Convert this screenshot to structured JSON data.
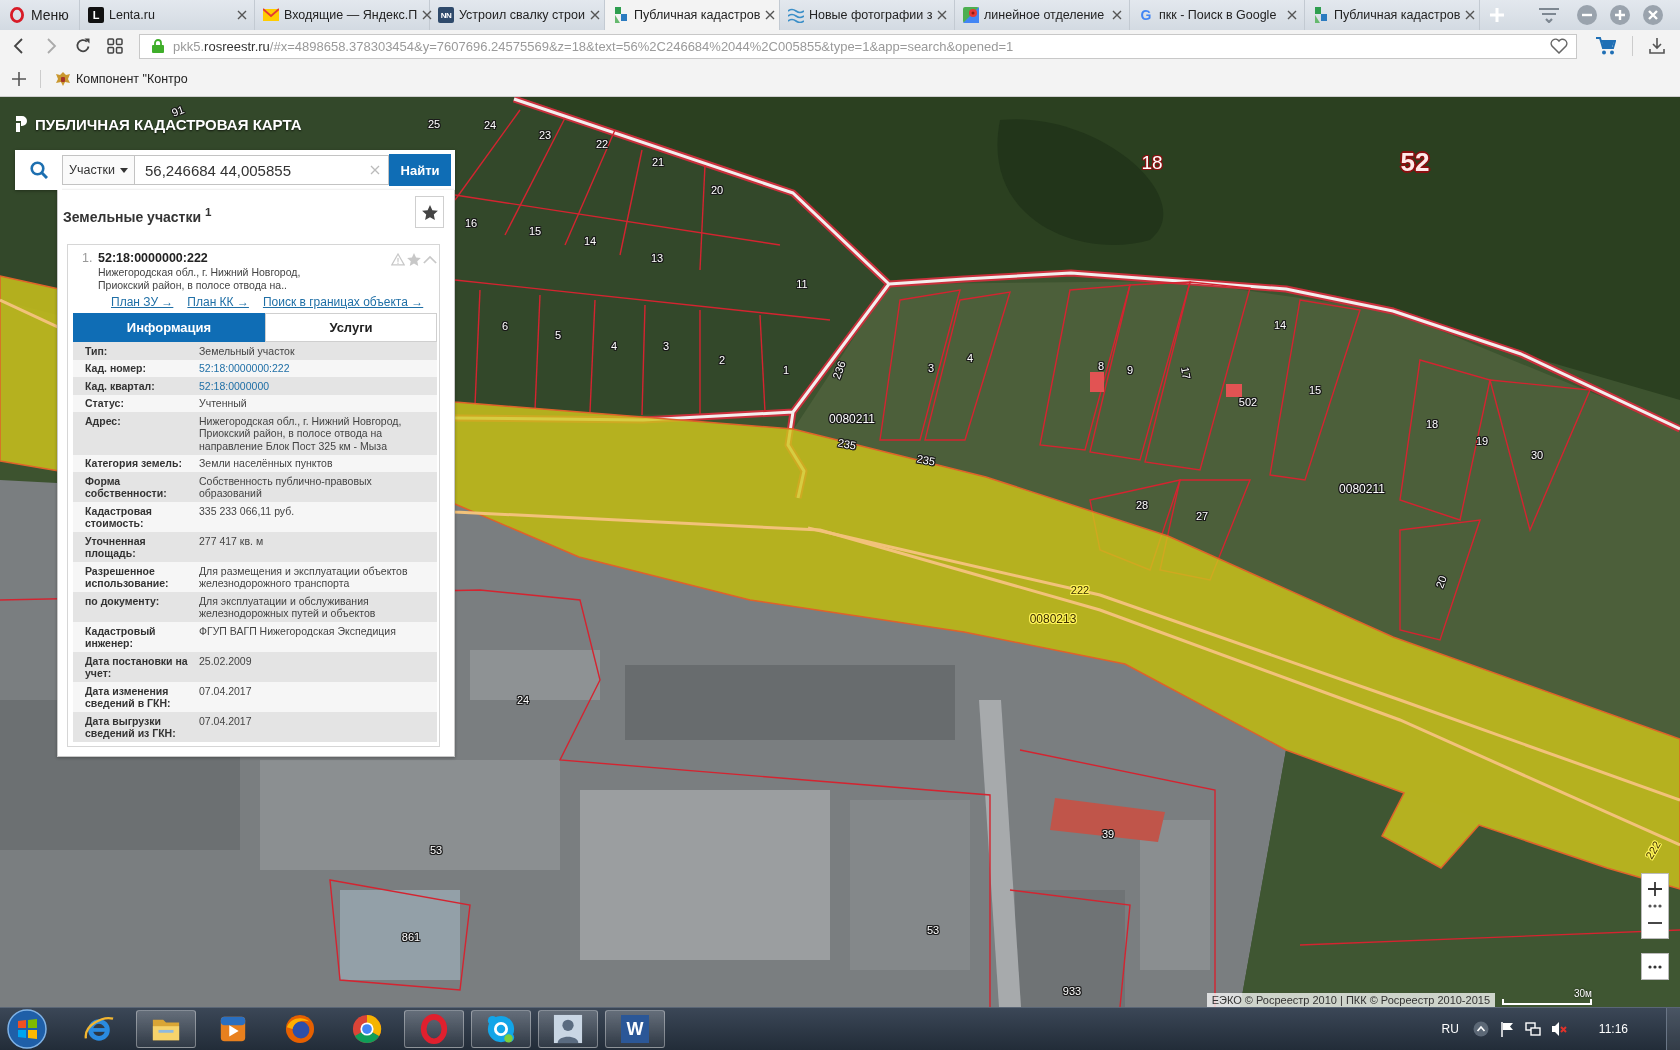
{
  "browser": {
    "menu_label": "Меню",
    "tabs": [
      {
        "title": "Lenta.ru",
        "kind": "lenta",
        "icon_text": "L",
        "selected": false
      },
      {
        "title": "Входящие — Яндекс.П",
        "kind": "mail",
        "selected": false
      },
      {
        "title": "Устроил свалку строи",
        "kind": "nn",
        "icon_text": "NN",
        "selected": false
      },
      {
        "title": "Публичная кадастров",
        "kind": "cadastre",
        "selected": true
      },
      {
        "title": "Новые фотографии з",
        "kind": "photos",
        "selected": false
      },
      {
        "title": "линейное отделение",
        "kind": "maps",
        "selected": false
      },
      {
        "title": "пкк - Поиск в Google",
        "kind": "google",
        "icon_text": "G",
        "selected": false
      },
      {
        "title": "Публичная кадастров",
        "kind": "cadastre",
        "selected": false
      }
    ],
    "address": {
      "prefix": "pkk5.",
      "domain": "rosreestr.ru",
      "path": "/#x=4898658.378303454&y=7607696.24575569&z=18&text=56%2C246684%2044%2C005855&type=1&app=search&opened=1"
    },
    "bookmarks": [
      {
        "label": "Компонент \"Контро"
      }
    ]
  },
  "map": {
    "app_title": "ПУБЛИЧНАЯ КАДАСТРОВАЯ КАРТА",
    "search": {
      "category": "Участки",
      "value": "56,246684 44,005855",
      "button": "Найти"
    },
    "results": {
      "title": "Земельные участки $^{1}$",
      "items": [
        {
          "number": "1.",
          "cadastral_number": "52:18:0000000:222",
          "address": "Нижегородская обл., г. Нижний Новгород, Приокский район, в полосе отвода на..",
          "links": [
            "План ЗУ →",
            "План КК →",
            "Поиск в границах объекта →"
          ],
          "tabs": [
            {
              "label": "Информация",
              "selected": true
            },
            {
              "label": "Услуги",
              "selected": false
            }
          ],
          "fields": [
            {
              "label": "Тип:",
              "value": "Земельный участок",
              "kind": "text"
            },
            {
              "label": "Кад. номер:",
              "value": "52:18:0000000:222",
              "kind": "link"
            },
            {
              "label": "Кад. квартал:",
              "value": "52:18:0000000",
              "kind": "link"
            },
            {
              "label": "Статус:",
              "value": "Учтенный",
              "kind": "text"
            },
            {
              "label": "Адрес:",
              "value": "Нижегородская обл., г. Нижний Новгород, Приокский район, в полосе отвода на направление Блок Пост 325 км - Мыза",
              "kind": "text"
            },
            {
              "label": "Категория земель:",
              "value": "Земли населённых пунктов",
              "kind": "text"
            },
            {
              "label": "Форма собственности:",
              "value": "Собственность публично-правовых образований",
              "kind": "text"
            },
            {
              "label": "Кадастровая стоимость:",
              "value": "335 233 066,11 руб.",
              "kind": "text"
            },
            {
              "label": "Уточненная площадь:",
              "value": "277 417 кв. м",
              "kind": "text"
            },
            {
              "label": "Разрешенное использование:",
              "value": "Для размещения и эксплуатации объектов железнодорожного транспорта",
              "kind": "text"
            },
            {
              "label": "по документу:",
              "value": "Для эксплуатации и обслуживания железнодорожных путей и объектов",
              "kind": "text"
            },
            {
              "label": "Кадастровый инженер:",
              "value": "ФГУП ВАГП Нижегородская Экспедиция",
              "kind": "text"
            },
            {
              "label": "Дата постановки на учет:",
              "value": "25.02.2009",
              "kind": "text"
            },
            {
              "label": "Дата изменения сведений в ГКН:",
              "value": "07.04.2017",
              "kind": "text"
            },
            {
              "label": "Дата выгрузки сведений из ГКН:",
              "value": "07.04.2017",
              "kind": "text"
            }
          ]
        }
      ]
    },
    "labels": [
      {
        "text": "91",
        "kind": "parcel",
        "highlighted": false
      },
      {
        "text": "25",
        "kind": "parcel",
        "highlighted": false
      },
      {
        "text": "24",
        "kind": "parcel",
        "highlighted": false
      },
      {
        "text": "23",
        "kind": "parcel",
        "highlighted": false
      },
      {
        "text": "22",
        "kind": "parcel",
        "highlighted": false
      },
      {
        "text": "21",
        "kind": "parcel",
        "highlighted": false
      },
      {
        "text": "20",
        "kind": "parcel",
        "highlighted": false
      },
      {
        "text": "16",
        "kind": "parcel",
        "highlighted": false
      },
      {
        "text": "15",
        "kind": "parcel",
        "highlighted": false
      },
      {
        "text": "14",
        "kind": "parcel",
        "highlighted": false
      },
      {
        "text": "13",
        "kind": "parcel",
        "highlighted": false
      },
      {
        "text": "11",
        "kind": "parcel",
        "highlighted": false
      },
      {
        "text": "18",
        "kind": "district",
        "highlighted": false
      },
      {
        "text": "52",
        "kind": "region",
        "highlighted": false
      },
      {
        "text": "6",
        "kind": "parcel",
        "highlighted": false
      },
      {
        "text": "5",
        "kind": "parcel",
        "highlighted": false
      },
      {
        "text": "4",
        "kind": "parcel",
        "highlighted": false
      },
      {
        "text": "3",
        "kind": "parcel",
        "highlighted": false
      },
      {
        "text": "2",
        "kind": "parcel",
        "highlighted": false
      },
      {
        "text": "1",
        "kind": "parcel",
        "highlighted": false
      },
      {
        "text": "236",
        "kind": "parcel",
        "highlighted": false
      },
      {
        "text": "3",
        "kind": "parcel",
        "highlighted": false
      },
      {
        "text": "4",
        "kind": "parcel",
        "highlighted": false
      },
      {
        "text": "8",
        "kind": "parcel",
        "highlighted": false
      },
      {
        "text": "9",
        "kind": "parcel",
        "highlighted": false
      },
      {
        "text": "17",
        "kind": "parcel",
        "highlighted": false
      },
      {
        "text": "14",
        "kind": "parcel",
        "highlighted": false
      },
      {
        "text": "502",
        "kind": "parcel",
        "highlighted": false
      },
      {
        "text": "15",
        "kind": "parcel",
        "highlighted": false
      },
      {
        "text": "0080211",
        "kind": "quarter",
        "highlighted": false
      },
      {
        "text": "235",
        "kind": "parcel",
        "highlighted": false
      },
      {
        "text": "235",
        "kind": "parcel",
        "highlighted": false
      },
      {
        "text": "18",
        "kind": "parcel",
        "highlighted": false
      },
      {
        "text": "19",
        "kind": "parcel",
        "highlighted": false
      },
      {
        "text": "30",
        "kind": "parcel",
        "highlighted": false
      },
      {
        "text": "0080211",
        "kind": "quarter",
        "highlighted": false
      },
      {
        "text": "28",
        "kind": "parcel",
        "highlighted": false
      },
      {
        "text": "27",
        "kind": "parcel",
        "highlighted": false
      },
      {
        "text": "20",
        "kind": "parcel",
        "highlighted": false
      },
      {
        "text": "222",
        "kind": "parcel",
        "highlighted": true
      },
      {
        "text": "0080213",
        "kind": "quarter",
        "highlighted": true
      },
      {
        "text": "24",
        "kind": "parcel",
        "highlighted": false
      },
      {
        "text": "53",
        "kind": "parcel",
        "highlighted": false
      },
      {
        "text": "39",
        "kind": "parcel",
        "highlighted": false
      },
      {
        "text": "53",
        "kind": "parcel",
        "highlighted": false
      },
      {
        "text": "861",
        "kind": "parcel",
        "highlighted": false
      },
      {
        "text": "933",
        "kind": "parcel",
        "highlighted": false
      },
      {
        "text": "222",
        "kind": "parcel",
        "highlighted": true
      }
    ],
    "attribution": "ЕЭКО © Росреестр 2010 | ПКК © Росреестр 2010-2015",
    "scale": "30м"
  },
  "taskbar": {
    "apps": [
      {
        "kind": "ie",
        "running": false
      },
      {
        "kind": "explorer",
        "running": true
      },
      {
        "kind": "media",
        "running": false
      },
      {
        "kind": "firefox",
        "running": false
      },
      {
        "kind": "chrome",
        "running": false
      },
      {
        "kind": "opera",
        "running": true
      },
      {
        "kind": "skype",
        "running": true
      },
      {
        "kind": "person",
        "running": true
      },
      {
        "kind": "word",
        "icon_text": "W",
        "running": true
      }
    ],
    "language": "RU",
    "time": "11:16"
  }
}
